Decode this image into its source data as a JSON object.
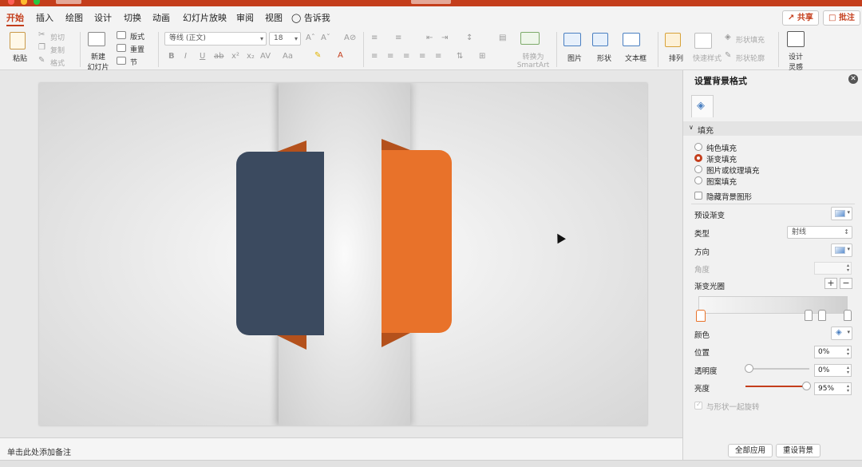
{
  "tabs": {
    "items": [
      "开始",
      "插入",
      "绘图",
      "设计",
      "切换",
      "动画",
      "幻灯片放映",
      "审阅",
      "视图"
    ],
    "tell_me": "告诉我",
    "share_label": "共享",
    "comment_label": "批注"
  },
  "ribbon": {
    "paste": "粘贴",
    "cut": "剪切",
    "copy": "复制",
    "format_painter": "格式",
    "new_slide_line1": "新建",
    "new_slide_line2": "幻灯片",
    "layout": "版式",
    "reset": "重置",
    "section": "节",
    "font_name": "等线 (正文)",
    "font_size": "18",
    "convert_line1": "转换为",
    "convert_line2": "SmartArt",
    "picture": "图片",
    "shapes": "形状",
    "textbox": "文本框",
    "arrange": "排列",
    "quick_styles": "快速样式",
    "shape_fill": "形状填充",
    "shape_outline": "形状轮廓",
    "designer_line1": "设计",
    "designer_line2": "灵感"
  },
  "notes": {
    "placeholder": "单击此处添加备注"
  },
  "panel": {
    "title": "设置背景格式",
    "section": "填充",
    "fill_options": [
      "纯色填充",
      "渐变填充",
      "图片或纹理填充",
      "图案填充"
    ],
    "selected_fill": "渐变填充",
    "hide_bg": "隐藏背景图形",
    "preset_label": "预设渐变",
    "type_label": "类型",
    "type_value": "射线",
    "direction_label": "方向",
    "angle_label": "角度",
    "stops_label": "渐变光圈",
    "color_label": "颜色",
    "position_label": "位置",
    "position_value": "0%",
    "transparency_label": "透明度",
    "transparency_value": "0%",
    "brightness_label": "亮度",
    "brightness_value": "95%",
    "rotate_with_shape": "与形状一起旋转",
    "apply_all": "全部应用",
    "reset_bg": "重设背景"
  },
  "colors": {
    "accent": "#c43e1c",
    "navy_card": "#3b4a5f",
    "orange_card": "#e8722a",
    "fold": "#b4511c"
  }
}
